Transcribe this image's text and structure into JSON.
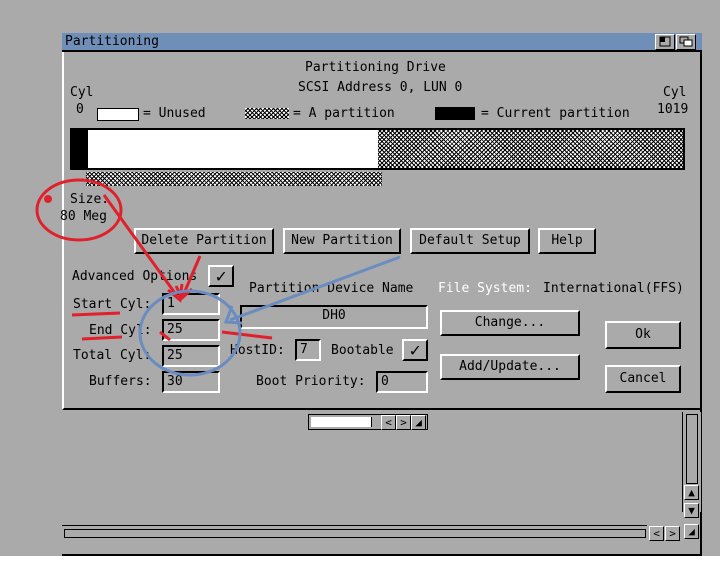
{
  "window": {
    "title": "Partitioning"
  },
  "header": {
    "title": "Partitioning Drive",
    "subtitle": "SCSI Address 0, LUN 0",
    "cyl_left_label": "Cyl",
    "cyl_left_value": "0",
    "cyl_right_label": "Cyl",
    "cyl_right_value": "1019"
  },
  "legend": {
    "unused": "= Unused",
    "partition": "= A partition",
    "current": "= Current partition"
  },
  "size": {
    "label": "Size:",
    "value": "80 Meg"
  },
  "buttons": {
    "delete_partition": "Delete Partition",
    "new_partition": "New Partition",
    "default_setup": "Default Setup",
    "help": "Help",
    "change": "Change...",
    "add_update": "Add/Update...",
    "ok": "Ok",
    "cancel": "Cancel"
  },
  "advanced": {
    "label": "Advanced Options",
    "checked": "✓"
  },
  "fields": {
    "start_cyl_label": "Start Cyl:",
    "start_cyl_value": "1",
    "end_cyl_label": "End Cyl:",
    "end_cyl_value": "25",
    "total_cyl_label": "Total Cyl:",
    "total_cyl_value": "25",
    "buffers_label": "Buffers:",
    "buffers_value": "30",
    "device_name_label": "Partition Device Name",
    "device_name_value": "DH0",
    "hostid_label": "HostID:",
    "hostid_value": "7",
    "bootable_label": "Bootable",
    "bootable_checked": "✓",
    "boot_priority_label": "Boot Priority:",
    "boot_priority_value": "0"
  },
  "filesystem": {
    "label": "File System:",
    "value": "International(FFS)"
  },
  "colors": {
    "workbench_gray": "#aaaaaa",
    "titlebar_blue": "#6f8fb8",
    "annotation_red": "#e0202a",
    "annotation_blue": "#6a8cc0"
  }
}
